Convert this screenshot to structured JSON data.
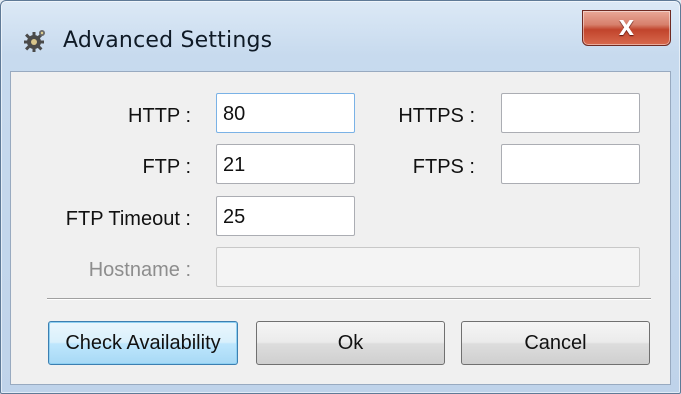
{
  "window": {
    "title": "Advanced Settings",
    "close_label": "X"
  },
  "form": {
    "http": {
      "label": "HTTP :",
      "value": "80"
    },
    "https": {
      "label": "HTTPS :",
      "value": ""
    },
    "ftp": {
      "label": "FTP :",
      "value": "21"
    },
    "ftps": {
      "label": "FTPS :",
      "value": ""
    },
    "ftp_timeout": {
      "label": "FTP Timeout :",
      "value": "25"
    },
    "hostname": {
      "label": "Hostname :",
      "value": "",
      "disabled": true
    }
  },
  "buttons": {
    "check": "Check Availability",
    "ok": "Ok",
    "cancel": "Cancel"
  },
  "icons": {
    "app": "gear-icon",
    "close": "close-icon"
  },
  "colors": {
    "close_button": "#c1442c",
    "focus_border": "#7ab2e6",
    "default_button_border": "#3c7fb1"
  }
}
